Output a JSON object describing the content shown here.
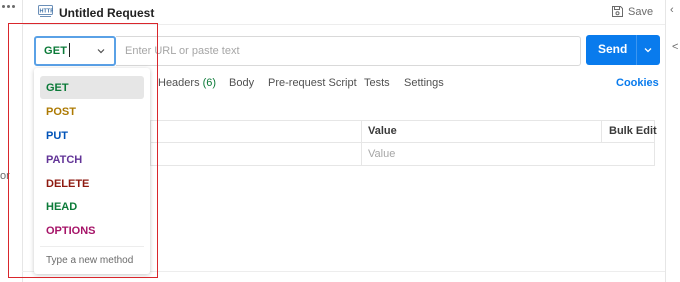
{
  "header": {
    "title": "Untitled Request",
    "save_label": "Save",
    "http_icon": "http-file-icon",
    "save_icon": "floppy-disk-icon"
  },
  "gutter": {
    "text": "or"
  },
  "url_bar": {
    "method_selected": "GET",
    "url_placeholder": "Enter URL or paste text",
    "url_value": "",
    "send_label": "Send"
  },
  "tabs": {
    "headers": "Headers",
    "headers_count": "(6)",
    "body": "Body",
    "pre_request": "Pre-request Script",
    "tests": "Tests",
    "settings": "Settings",
    "cookies": "Cookies"
  },
  "params_table": {
    "col_value": "Value",
    "col_bulk_edit": "Bulk Edit",
    "row_value_placeholder": "Value"
  },
  "method_dropdown": {
    "items": [
      {
        "label": "GET",
        "color": "#0b7a38",
        "selected": true
      },
      {
        "label": "POST",
        "color": "#ad7a03",
        "selected": false
      },
      {
        "label": "PUT",
        "color": "#0053b8",
        "selected": false
      },
      {
        "label": "PATCH",
        "color": "#623497",
        "selected": false
      },
      {
        "label": "DELETE",
        "color": "#8e1a10",
        "selected": false
      },
      {
        "label": "HEAD",
        "color": "#0b7a38",
        "selected": false
      },
      {
        "label": "OPTIONS",
        "color": "#a61468",
        "selected": false
      }
    ],
    "new_method_placeholder": "Type a new method"
  },
  "colors": {
    "accent": "#097bed",
    "highlight": "#d9262c",
    "focus_border": "#5aa1e6"
  }
}
